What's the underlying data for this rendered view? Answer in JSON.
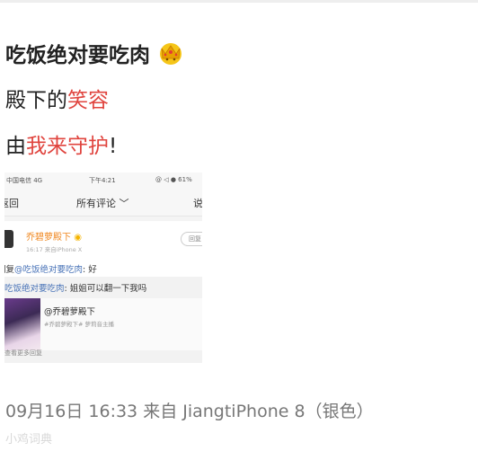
{
  "post": {
    "title": "吃饭绝对要吃肉",
    "line2_prefix": "殿下的",
    "line2_highlight": "笑容",
    "line3_prefix": "由",
    "line3_highlight": "我来守护",
    "line3_suffix": "!",
    "footer_meta": "09月16日 16:33  来自 JiangtiPhone 8（银色）",
    "watermark": "小鸡词典",
    "crown_icon": "crown-emoji-icon",
    "highlight_color": "#e0443e"
  },
  "screenshot": {
    "status_carrier": "中国电信  4G",
    "status_time": "下午4:21",
    "status_battery": "@ ◁ ● 61%",
    "nav_back": "返回",
    "nav_title": "所有评论 ﹀",
    "nav_right": "说",
    "user_name": "乔碧萝殿下",
    "user_meta": "16:17  来自iPhone X",
    "reply_button": "回复",
    "reply_prefix": "回复",
    "reply_mention": "@吃饭绝对要吃肉",
    "reply_text": ": 好",
    "quote_mention": "吃饭绝对要吃肉",
    "quote_text": ": 姐姐可以翻一下我吗",
    "inner_title": "@乔碧萝殿下",
    "inner_sub": "#乔碧萝殿下#  萝莉音主播",
    "bottom_peek": "查看更多回复"
  }
}
